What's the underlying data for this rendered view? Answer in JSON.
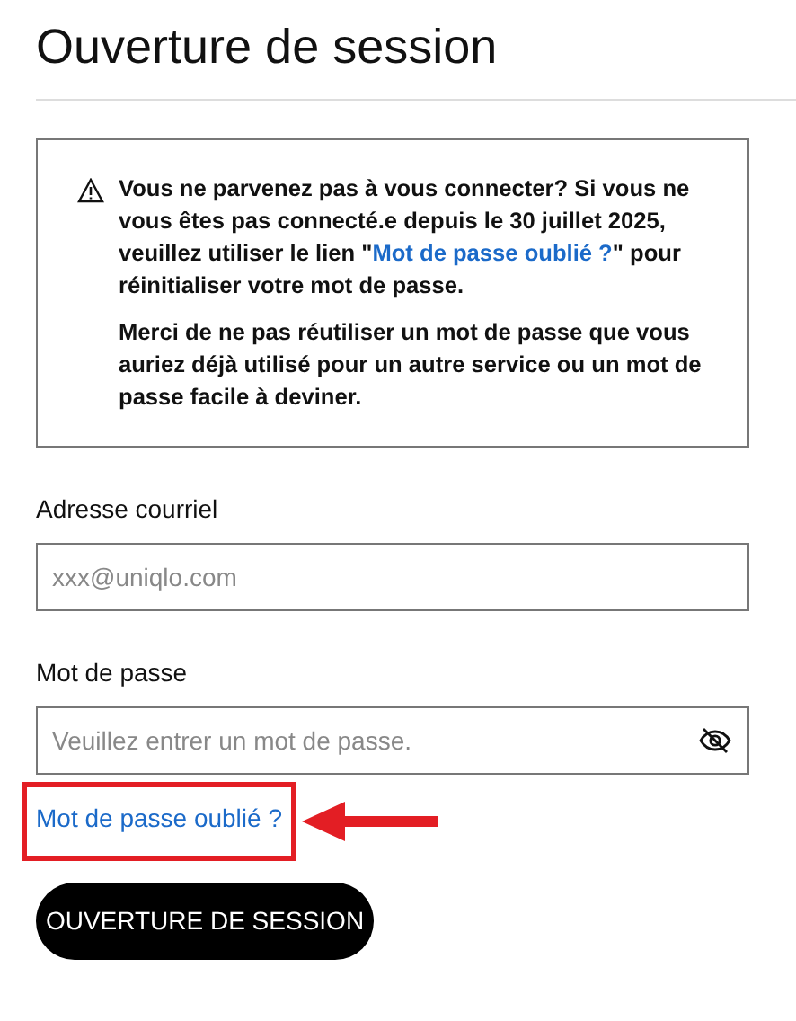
{
  "title": "Ouverture de session",
  "notice": {
    "before": "Vous ne parvenez pas à vous connecter? Si vous ne vous êtes pas connecté.e depuis le 30 juillet 2025, veuillez utiliser le lien \"",
    "link": "Mot de passe oublié ?",
    "after": "\" pour réinitialiser votre mot de passe.",
    "second": "Merci de ne pas réutiliser un mot de passe que vous auriez déjà utilisé pour un autre service ou un mot de passe facile à deviner."
  },
  "fields": [
    {
      "kind": "email",
      "label": "Adresse courriel",
      "placeholder": "xxx@uniqlo.com"
    },
    {
      "kind": "password",
      "label": "Mot de passe",
      "placeholder": "Veuillez entrer un mot de passe."
    }
  ],
  "forgot_link": "Mot de passe oublié ?",
  "callout": {
    "kind": "box-and-arrow"
  },
  "submit": "OUVERTURE DE SESSION"
}
